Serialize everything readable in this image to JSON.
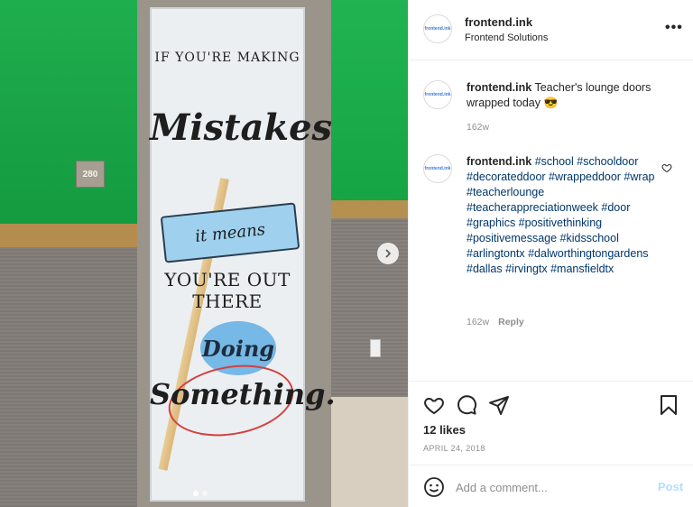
{
  "photo": {
    "room_number": "280",
    "door_lines": [
      "IF YOU'RE MAKING",
      "Mistakes",
      "it means",
      "YOU'RE OUT THERE",
      "Doing",
      "Something."
    ],
    "slide_count": 2,
    "active_slide": 1
  },
  "header": {
    "username": "frontend.ink",
    "subtitle": "Frontend Solutions",
    "avatar_logo": "frontend.ink",
    "more_icon": "more-icon"
  },
  "caption": {
    "username": "frontend.ink",
    "text": "Teacher's lounge doors wrapped today 😎",
    "time": "162w"
  },
  "comment": {
    "username": "frontend.ink",
    "hashtags": "#school #schooldoor #decorateddoor #wrappeddoor #wrap #teacherlounge #teacherappreciationweek #door #graphics #positivethinking #positivemessage #kidsschool #arlingtontx #dalworthingtongardens #dallas #irvingtx #mansfieldtx",
    "time": "162w",
    "reply_label": "Reply"
  },
  "actions": {
    "like_icon": "heart-icon",
    "comment_icon": "comment-icon",
    "share_icon": "paper-plane-icon",
    "save_icon": "bookmark-icon"
  },
  "likes": "12 likes",
  "date": "APRIL 24, 2018",
  "add_comment": {
    "placeholder": "Add a comment...",
    "post_label": "Post",
    "post_color": "#b2dffc"
  },
  "colors": {
    "link": "#00376b",
    "muted": "#8e8e8e",
    "wall_green": "#1fae4e"
  }
}
